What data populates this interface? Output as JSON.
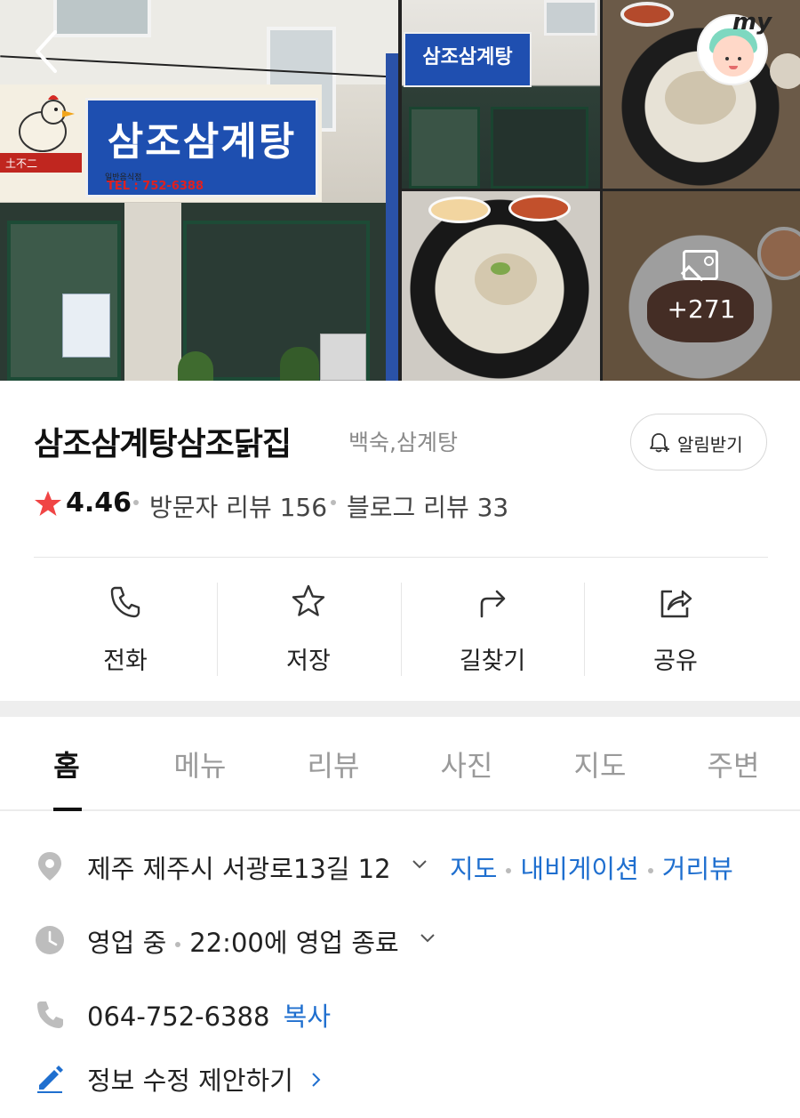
{
  "photos": {
    "more_count": "+271",
    "sign_title": "삼조삼계탕",
    "sign_tel": "TEL : 752-6388",
    "sign_sub": "일반음식점",
    "sign_red": "土不二"
  },
  "header": {
    "my_label": "my"
  },
  "place": {
    "name": "삼조삼계탕삼조닭집",
    "category": "백숙,삼계탕",
    "notify_label": "알림받기",
    "rating": "4.46",
    "visitor_reviews": "방문자 리뷰 156",
    "blog_reviews": "블로그 리뷰 33"
  },
  "actions": [
    {
      "label": "전화",
      "icon": "phone-icon"
    },
    {
      "label": "저장",
      "icon": "star-icon"
    },
    {
      "label": "길찾기",
      "icon": "directions-icon"
    },
    {
      "label": "공유",
      "icon": "share-icon"
    }
  ],
  "tabs": [
    "홈",
    "메뉴",
    "리뷰",
    "사진",
    "지도",
    "주변"
  ],
  "info": {
    "address": "제주 제주시 서광로13길 12",
    "address_links": [
      "지도",
      "내비게이션",
      "거리뷰"
    ],
    "hours_status": "영업 중",
    "hours_detail": "22:00에 영업 종료",
    "phone": "064-752-6388",
    "phone_copy": "복사",
    "edit_suggest": "정보 수정 제안하기"
  },
  "colors": {
    "accent_link": "#1f6fcf",
    "star": "#f04545",
    "text": "#111111",
    "muted": "#8a8a8a"
  }
}
